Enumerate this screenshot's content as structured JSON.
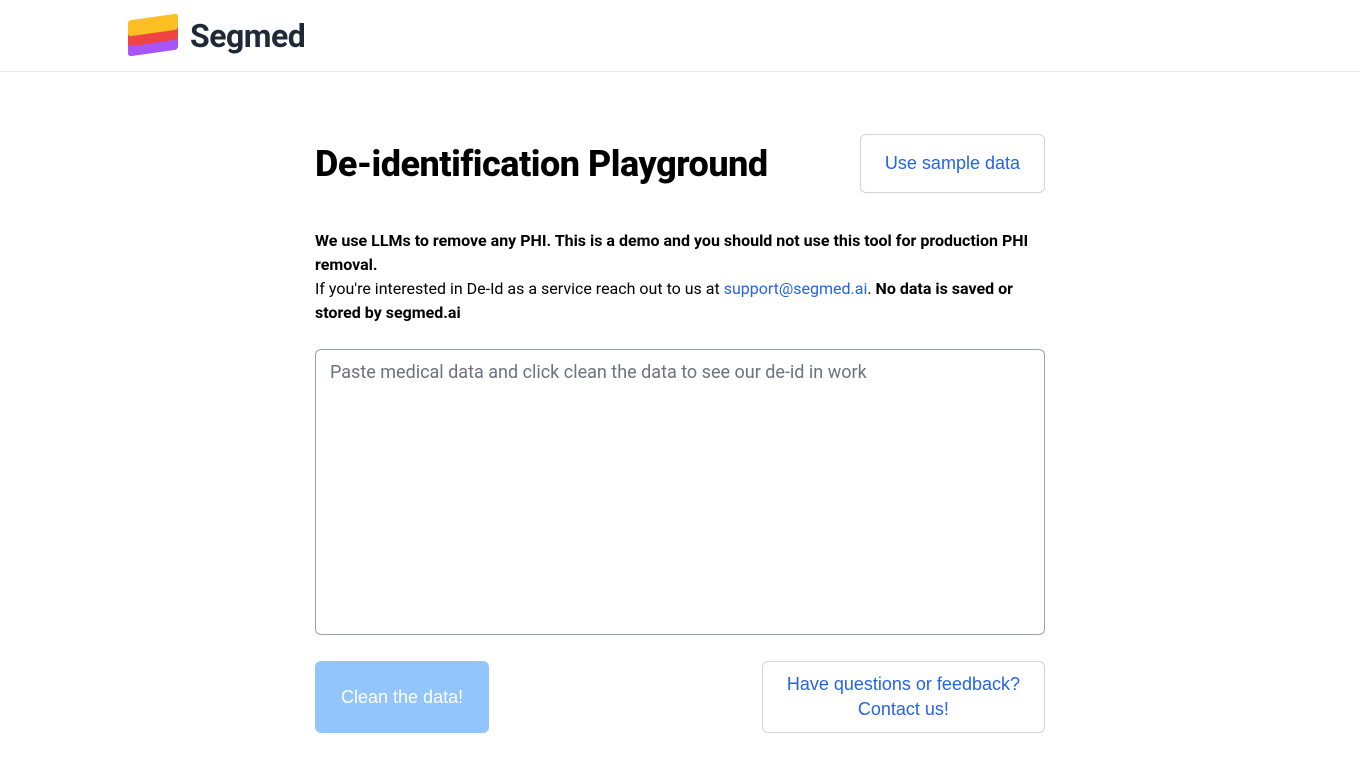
{
  "header": {
    "brand_name": "Segmed"
  },
  "main": {
    "title": "De-identification Playground",
    "sample_button_label": "Use sample data",
    "description": {
      "bold_intro": "We use LLMs to remove any PHI. This is a demo and you should not use this tool for production PHI removal.",
      "line2_prefix": "If you're interested in De-Id as a service reach out to us at ",
      "support_email": "support@segmed.ai",
      "line2_after_email": ". ",
      "bold_outro": "No data is saved or stored by segmed.ai"
    },
    "textarea_placeholder": "Paste medical data and click clean the data to see our de-id in work",
    "textarea_value": "",
    "clean_button_label": "Clean the data!",
    "feedback_button_line1": "Have questions or feedback?",
    "feedback_button_line2": "Contact us!"
  },
  "colors": {
    "link": "#2563eb",
    "clean_button_bg": "#93c5fd",
    "border": "#d1d5db"
  }
}
